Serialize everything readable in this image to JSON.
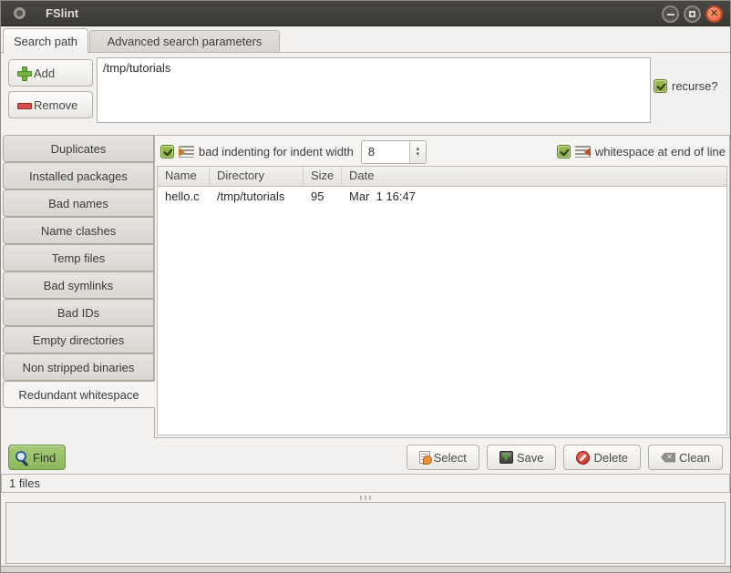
{
  "window": {
    "title": "FSlint",
    "controls": {
      "minimize": "minimize",
      "maximize": "maximize",
      "close_glyph": "✕"
    }
  },
  "colors": {
    "titlebar": "#3b3a36",
    "window_bg": "#f2f1f0",
    "close_button": "#ea6238",
    "checkbox_green": "#8bb13f",
    "find_button_green": "#97c069",
    "delete_red": "#c22b1d"
  },
  "icons": {
    "app": "gray-circle-app-icon",
    "add": "green-plus",
    "remove": "red-minus",
    "recurse_checkbox": "green-checked",
    "indent": "lines-with-right-arrow",
    "trailing_whitespace": "lines-with-left-arrow",
    "find": "magnifying-glass",
    "select": "document-with-hand",
    "save": "drive-with-green-down-arrow",
    "delete": "red-no-entry-circle",
    "clean": "backspace-with-x",
    "clean_x_glyph": "✕",
    "spin_up": "▴",
    "spin_down": "▾"
  },
  "tabs": {
    "search_path": "Search path",
    "advanced": "Advanced search parameters"
  },
  "search_panel": {
    "add": "Add",
    "remove": "Remove",
    "path": "/tmp/tutorials",
    "recurse": "recurse?"
  },
  "sidebar": {
    "active_index": 9,
    "items": [
      "Duplicates",
      "Installed packages",
      "Bad names",
      "Name clashes",
      "Temp files",
      "Bad symlinks",
      "Bad IDs",
      "Empty directories",
      "Non stripped binaries",
      "Redundant whitespace"
    ]
  },
  "options": {
    "indent": "bad indenting for indent width",
    "indent_width": "8",
    "indent_checked": true,
    "whitespace": "whitespace at end of line",
    "whitespace_checked": true
  },
  "table": {
    "columns": [
      "Name",
      "Directory",
      "Size",
      "Date"
    ],
    "rows": [
      {
        "name": "hello.c",
        "directory": "/tmp/tutorials",
        "size": "95",
        "date": "Mar  1 16:47"
      }
    ]
  },
  "actions": {
    "find": "Find",
    "select": "Select",
    "save": "Save",
    "delete": "Delete",
    "clean": "Clean"
  },
  "status": {
    "files": "1 files"
  }
}
